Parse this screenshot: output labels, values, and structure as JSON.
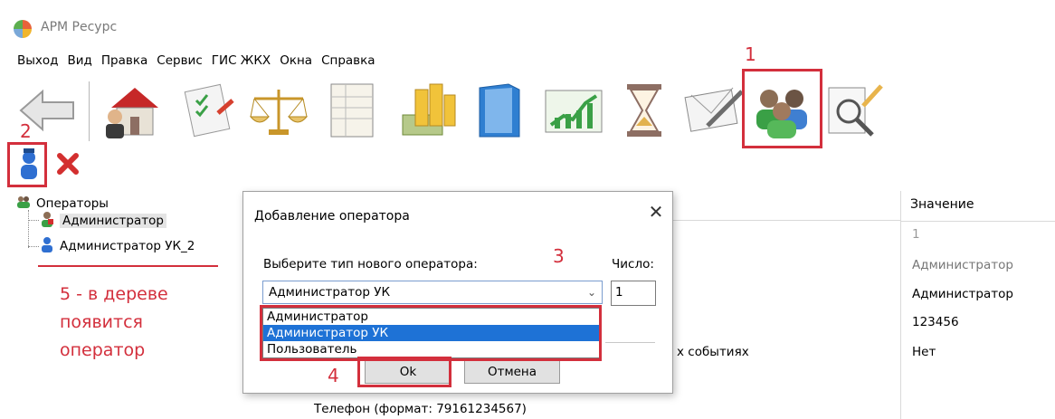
{
  "app": {
    "title": "АРМ Ресурс"
  },
  "menu": [
    "Выход",
    "Вид",
    "Правка",
    "Сервис",
    "ГИС ЖКХ",
    "Окна",
    "Справка"
  ],
  "toolbar": {
    "icons": [
      "back-arrow-icon",
      "house-owner-icon",
      "checklist-icon",
      "scales-icon",
      "ledger-icon",
      "coins-banknotes-icon",
      "folder-book-icon",
      "chart-growth-icon",
      "hourglass-icon",
      "envelope-pen-icon",
      "operators-group-icon",
      "document-magnifier-icon"
    ]
  },
  "annotations": {
    "n1": "1",
    "n2": "2",
    "n3": "3",
    "n4": "4",
    "n5_lines": [
      "5 - в дереве",
      "появится",
      "оператор"
    ]
  },
  "tree": {
    "root": "Операторы",
    "items": [
      "Администратор",
      "Администратор УК_2"
    ]
  },
  "grid": {
    "value_header": "Значение",
    "values": [
      "1",
      "Администратор",
      "Администратор",
      "123456",
      "Нет"
    ],
    "events_label": "х событиях",
    "phone_label": "Телефон (формат: 79161234567)"
  },
  "dialog": {
    "title": "Добавление оператора",
    "close": "✕",
    "type_label": "Выберите тип нового оператора:",
    "count_label": "Число:",
    "combo_value": "Администратор УК",
    "count_value": "1",
    "options": [
      "Администратор",
      "Администратор УК",
      "Пользователь"
    ],
    "selected_option": 1,
    "ok_label": "Ok",
    "cancel_label": "Отмена"
  },
  "colors": {
    "annotation_red": "#d32f3c",
    "selection_blue": "#1e72d6"
  }
}
